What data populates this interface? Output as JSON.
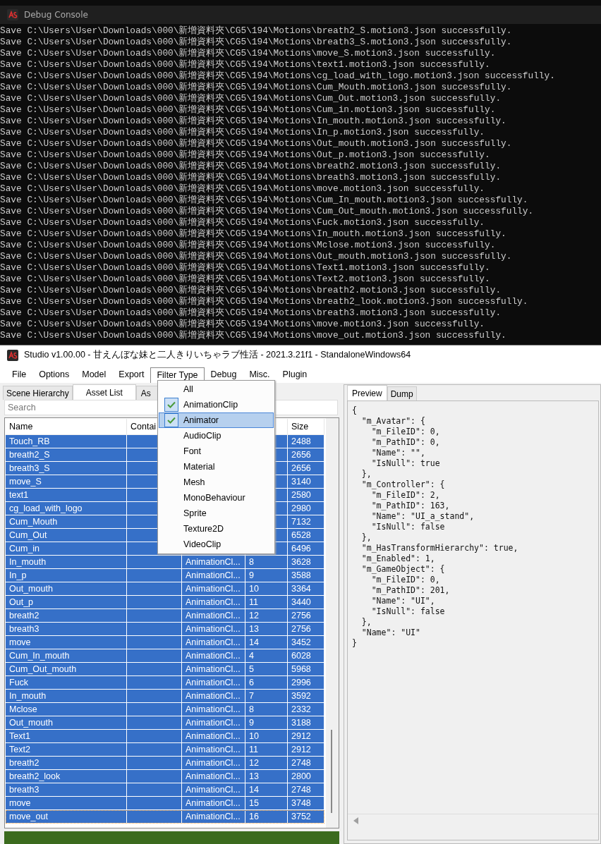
{
  "console": {
    "title": "Debug Console",
    "lines": [
      "Save C:\\Users\\User\\Downloads\\000\\新增資料夾\\CG5\\194\\Motions\\breath2_S.motion3.json successfully.",
      "Save C:\\Users\\User\\Downloads\\000\\新增資料夾\\CG5\\194\\Motions\\breath3_S.motion3.json successfully.",
      "Save C:\\Users\\User\\Downloads\\000\\新增資料夾\\CG5\\194\\Motions\\move_S.motion3.json successfully.",
      "Save C:\\Users\\User\\Downloads\\000\\新增資料夾\\CG5\\194\\Motions\\text1.motion3.json successfully.",
      "Save C:\\Users\\User\\Downloads\\000\\新增資料夾\\CG5\\194\\Motions\\cg_load_with_logo.motion3.json successfully.",
      "Save C:\\Users\\User\\Downloads\\000\\新增資料夾\\CG5\\194\\Motions\\Cum_Mouth.motion3.json successfully.",
      "Save C:\\Users\\User\\Downloads\\000\\新增資料夾\\CG5\\194\\Motions\\Cum_Out.motion3.json successfully.",
      "Save C:\\Users\\User\\Downloads\\000\\新增資料夾\\CG5\\194\\Motions\\Cum_in.motion3.json successfully.",
      "Save C:\\Users\\User\\Downloads\\000\\新增資料夾\\CG5\\194\\Motions\\In_mouth.motion3.json successfully.",
      "Save C:\\Users\\User\\Downloads\\000\\新增資料夾\\CG5\\194\\Motions\\In_p.motion3.json successfully.",
      "Save C:\\Users\\User\\Downloads\\000\\新增資料夾\\CG5\\194\\Motions\\Out_mouth.motion3.json successfully.",
      "Save C:\\Users\\User\\Downloads\\000\\新增資料夾\\CG5\\194\\Motions\\Out_p.motion3.json successfully.",
      "Save C:\\Users\\User\\Downloads\\000\\新增資料夾\\CG5\\194\\Motions\\breath2.motion3.json successfully.",
      "Save C:\\Users\\User\\Downloads\\000\\新增資料夾\\CG5\\194\\Motions\\breath3.motion3.json successfully.",
      "Save C:\\Users\\User\\Downloads\\000\\新增資料夾\\CG5\\194\\Motions\\move.motion3.json successfully.",
      "Save C:\\Users\\User\\Downloads\\000\\新增資料夾\\CG5\\194\\Motions\\Cum_In_mouth.motion3.json successfully.",
      "Save C:\\Users\\User\\Downloads\\000\\新增資料夾\\CG5\\194\\Motions\\Cum_Out_mouth.motion3.json successfully.",
      "Save C:\\Users\\User\\Downloads\\000\\新增資料夾\\CG5\\194\\Motions\\Fuck.motion3.json successfully.",
      "Save C:\\Users\\User\\Downloads\\000\\新增資料夾\\CG5\\194\\Motions\\In_mouth.motion3.json successfully.",
      "Save C:\\Users\\User\\Downloads\\000\\新增資料夾\\CG5\\194\\Motions\\Mclose.motion3.json successfully.",
      "Save C:\\Users\\User\\Downloads\\000\\新增資料夾\\CG5\\194\\Motions\\Out_mouth.motion3.json successfully.",
      "Save C:\\Users\\User\\Downloads\\000\\新增資料夾\\CG5\\194\\Motions\\Text1.motion3.json successfully.",
      "Save C:\\Users\\User\\Downloads\\000\\新增資料夾\\CG5\\194\\Motions\\Text2.motion3.json successfully.",
      "Save C:\\Users\\User\\Downloads\\000\\新增資料夾\\CG5\\194\\Motions\\breath2.motion3.json successfully.",
      "Save C:\\Users\\User\\Downloads\\000\\新增資料夾\\CG5\\194\\Motions\\breath2_look.motion3.json successfully.",
      "Save C:\\Users\\User\\Downloads\\000\\新增資料夾\\CG5\\194\\Motions\\breath3.motion3.json successfully.",
      "Save C:\\Users\\User\\Downloads\\000\\新增資料夾\\CG5\\194\\Motions\\move.motion3.json successfully.",
      "Save C:\\Users\\User\\Downloads\\000\\新增資料夾\\CG5\\194\\Motions\\move_out.motion3.json successfully."
    ]
  },
  "studio": {
    "title": "Studio v1.00.00 - 甘えんぼな妹と二人きりいちゃラブ性活 - 2021.3.21f1 - StandaloneWindows64",
    "menu": [
      {
        "label": "File",
        "selected": false
      },
      {
        "label": "Options",
        "selected": false
      },
      {
        "label": "Model",
        "selected": false
      },
      {
        "label": "Export",
        "selected": false
      },
      {
        "label": "Filter Type",
        "selected": true
      },
      {
        "label": "Debug",
        "selected": false
      },
      {
        "label": "Misc.",
        "selected": false
      },
      {
        "label": "Plugin",
        "selected": false
      }
    ],
    "filter_menu": [
      {
        "label": "All",
        "checked": false,
        "selected": false
      },
      {
        "label": "AnimationClip",
        "checked": true,
        "selected": false
      },
      {
        "label": "Animator",
        "checked": true,
        "selected": true
      },
      {
        "label": "AudioClip",
        "checked": false,
        "selected": false
      },
      {
        "label": "Font",
        "checked": false,
        "selected": false
      },
      {
        "label": "Material",
        "checked": false,
        "selected": false
      },
      {
        "label": "Mesh",
        "checked": false,
        "selected": false
      },
      {
        "label": "MonoBehaviour",
        "checked": false,
        "selected": false
      },
      {
        "label": "Sprite",
        "checked": false,
        "selected": false
      },
      {
        "label": "Texture2D",
        "checked": false,
        "selected": false
      },
      {
        "label": "VideoClip",
        "checked": false,
        "selected": false
      }
    ],
    "left_tabs": [
      {
        "label": "Scene Hierarchy",
        "selected": false
      },
      {
        "label": "Asset List",
        "selected": true
      },
      {
        "label": "As",
        "selected": false
      }
    ],
    "search": {
      "placeholder": "Search"
    },
    "table": {
      "header": {
        "name": "Name",
        "container": "Contai",
        "size": "Size"
      },
      "rows": [
        {
          "name": "Touch_RB",
          "size": "2488",
          "selected": true
        },
        {
          "name": "breath2_S",
          "size": "2656",
          "selected": true
        },
        {
          "name": "breath3_S",
          "size": "2656",
          "selected": true
        },
        {
          "name": "move_S",
          "size": "3140",
          "selected": true
        },
        {
          "name": "text1",
          "size": "2580",
          "selected": true
        },
        {
          "name": "cg_load_with_logo",
          "size": "2980",
          "selected": true
        },
        {
          "name": "Cum_Mouth",
          "size": "7132",
          "selected": true
        },
        {
          "name": "Cum_Out",
          "size": "6528",
          "selected": true
        },
        {
          "name": "Cum_in",
          "size": "6496",
          "selected": true
        },
        {
          "name": "In_mouth",
          "type": "AnimationCl...",
          "path_id": "8",
          "size": "3628",
          "selected": true
        },
        {
          "name": "In_p",
          "type": "AnimationCl...",
          "path_id": "9",
          "size": "3588",
          "selected": true
        },
        {
          "name": "Out_mouth",
          "type": "AnimationCl...",
          "path_id": "10",
          "size": "3364",
          "selected": true
        },
        {
          "name": "Out_p",
          "type": "AnimationCl...",
          "path_id": "11",
          "size": "3440",
          "selected": true
        },
        {
          "name": "breath2",
          "type": "AnimationCl...",
          "path_id": "12",
          "size": "2756",
          "selected": true
        },
        {
          "name": "breath3",
          "type": "AnimationCl...",
          "path_id": "13",
          "size": "2756",
          "selected": true
        },
        {
          "name": "move",
          "type": "AnimationCl...",
          "path_id": "14",
          "size": "3452",
          "selected": true
        },
        {
          "name": "Cum_In_mouth",
          "type": "AnimationCl...",
          "path_id": "4",
          "size": "6028",
          "selected": true
        },
        {
          "name": "Cum_Out_mouth",
          "type": "AnimationCl...",
          "path_id": "5",
          "size": "5968",
          "selected": true
        },
        {
          "name": "Fuck",
          "type": "AnimationCl...",
          "path_id": "6",
          "size": "2996",
          "selected": true
        },
        {
          "name": "In_mouth",
          "type": "AnimationCl...",
          "path_id": "7",
          "size": "3592",
          "selected": true
        },
        {
          "name": "Mclose",
          "type": "AnimationCl...",
          "path_id": "8",
          "size": "2332",
          "selected": true
        },
        {
          "name": "Out_mouth",
          "type": "AnimationCl...",
          "path_id": "9",
          "size": "3188",
          "selected": true
        },
        {
          "name": "Text1",
          "type": "AnimationCl...",
          "path_id": "10",
          "size": "2912",
          "selected": true
        },
        {
          "name": "Text2",
          "type": "AnimationCl...",
          "path_id": "11",
          "size": "2912",
          "selected": true
        },
        {
          "name": "breath2",
          "type": "AnimationCl...",
          "path_id": "12",
          "size": "2748",
          "selected": true
        },
        {
          "name": "breath2_look",
          "type": "AnimationCl...",
          "path_id": "13",
          "size": "2800",
          "selected": true
        },
        {
          "name": "breath3",
          "type": "AnimationCl...",
          "path_id": "14",
          "size": "2748",
          "selected": true
        },
        {
          "name": "move",
          "type": "AnimationCl...",
          "path_id": "15",
          "size": "3748",
          "selected": true
        },
        {
          "name": "move_out",
          "type": "AnimationCl...",
          "path_id": "16",
          "size": "3752",
          "selected": true
        }
      ]
    },
    "progress": {
      "level": 1
    },
    "right_tabs": [
      {
        "label": "Preview",
        "selected": true
      },
      {
        "label": "Dump",
        "selected": false
      }
    ],
    "preview": {
      "lines": [
        "{",
        "  \"m_Avatar\": {",
        "    \"m_FileID\": 0,",
        "    \"m_PathID\": 0,",
        "    \"Name\": \"\",",
        "    \"IsNull\": true",
        "  },",
        "  \"m_Controller\": {",
        "    \"m_FileID\": 2,",
        "    \"m_PathID\": 163,",
        "    \"Name\": \"UI_a_stand\",",
        "    \"IsNull\": false",
        "  },",
        "  \"m_HasTransformHierarchy\": true,",
        "  \"m_Enabled\": 1,",
        "  \"m_GameObject\": {",
        "    \"m_FileID\": 0,",
        "    \"m_PathID\": 201,",
        "    \"Name\": \"UI\",",
        "    \"IsNull\": false",
        "  },",
        "  \"Name\": \"UI\"",
        "}"
      ]
    }
  }
}
